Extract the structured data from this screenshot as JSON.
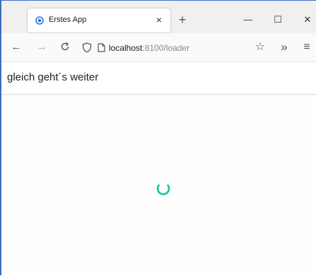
{
  "browser": {
    "tab": {
      "title": "Erstes App",
      "close_glyph": "×",
      "icon": "app-favicon-icon"
    },
    "new_tab_glyph": "+",
    "window_controls": {
      "minimize_glyph": "—",
      "maximize_glyph": "☐",
      "close_glyph": "✕"
    },
    "nav": {
      "back_glyph": "←",
      "forward_glyph": "→",
      "reload_glyph": "↻",
      "overflow_glyph": "»",
      "menu_glyph": "≡",
      "bookmark_glyph": "☆"
    },
    "url": {
      "host": "localhost",
      "path": ":8100/loader"
    }
  },
  "page": {
    "title": "gleich geht´s weiter",
    "spinner": {
      "state": "loading",
      "color": "#12c7a0"
    }
  },
  "colors": {
    "window_border": "#3c6fbf",
    "accent": "#12c7a0",
    "favicon": "#1f7ae0"
  }
}
